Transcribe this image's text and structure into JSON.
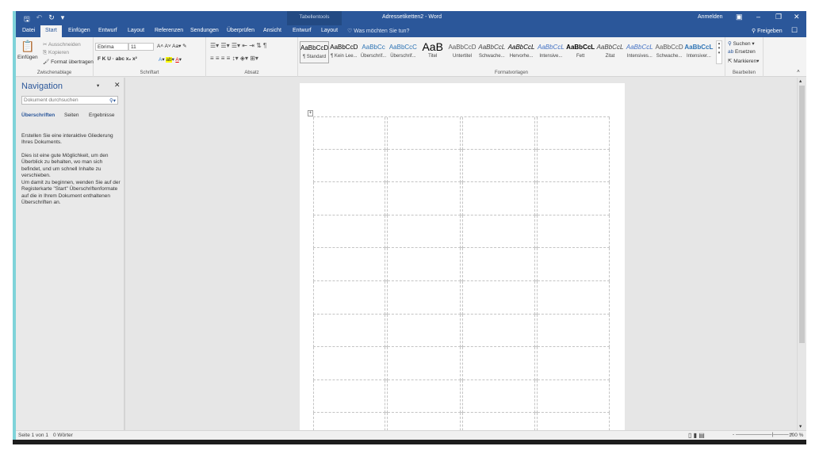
{
  "title": {
    "quick_access": [
      "save-icon",
      "undo-icon",
      "redo-icon",
      "customize-icon"
    ],
    "contextual": "Tabellentools",
    "document": "Adressetiketten2 - Word",
    "signin": "Anmelden",
    "window_controls": [
      "ribbon-options",
      "minimize",
      "restore",
      "close"
    ]
  },
  "tabs": [
    {
      "label": "Datei"
    },
    {
      "label": "Start",
      "active": true
    },
    {
      "label": "Einfügen"
    },
    {
      "label": "Entwurf"
    },
    {
      "label": "Layout"
    },
    {
      "label": "Referenzen"
    },
    {
      "label": "Sendungen"
    },
    {
      "label": "Überprüfen"
    },
    {
      "label": "Ansicht"
    },
    {
      "label": "Entwurf"
    },
    {
      "label": "Layout"
    }
  ],
  "tell_me": "Was möchten Sie tun?",
  "share": "Freigeben",
  "ribbon": {
    "clipboard": {
      "label": "Zwischenablage",
      "paste": "Einfügen",
      "cut": "Ausschneiden",
      "copy": "Kopieren",
      "format_painter": "Format übertragen"
    },
    "font": {
      "label": "Schriftart",
      "font_name": "Ebrima",
      "font_size": "11",
      "buttons": "F  K  U  ·  abc  x₂  x²"
    },
    "paragraph": {
      "label": "Absatz"
    },
    "styles": {
      "label": "Formatvorlagen",
      "items": [
        {
          "preview": "AaBbCcD",
          "name": "¶ Standard",
          "color": "#000"
        },
        {
          "preview": "AaBbCcD",
          "name": "¶ Kein Lee...",
          "color": "#000"
        },
        {
          "preview": "AaBbCc",
          "name": "Überschrif...",
          "color": "#2e74b5"
        },
        {
          "preview": "AaBbCcC",
          "name": "Überschrif...",
          "color": "#2e74b5"
        },
        {
          "preview": "AaB",
          "name": "Titel",
          "color": "#000"
        },
        {
          "preview": "AaBbCcD",
          "name": "Untertitel",
          "color": "#595959"
        },
        {
          "preview": "AaBbCcL",
          "name": "Schwache...",
          "color": "#404040"
        },
        {
          "preview": "AaBbCcL",
          "name": "Hervorhe...",
          "color": "#000"
        },
        {
          "preview": "AaBbCcL",
          "name": "Intensive...",
          "color": "#4472c4"
        },
        {
          "preview": "AaBbCcL",
          "name": "Fett",
          "color": "#000"
        },
        {
          "preview": "AaBbCcL",
          "name": "Zitat",
          "color": "#404040"
        },
        {
          "preview": "AaBbCcL",
          "name": "Intensives...",
          "color": "#4472c4"
        },
        {
          "preview": "AaBbCcD",
          "name": "Schwache...",
          "color": "#595959"
        },
        {
          "preview": "AaBbCcL",
          "name": "Intensiver...",
          "color": "#2e74b5"
        }
      ]
    },
    "editing": {
      "label": "Bearbeiten",
      "find": "Suchen",
      "replace": "Ersetzen",
      "select": "Markieren"
    }
  },
  "navigation": {
    "title": "Navigation",
    "search_placeholder": "Dokument durchsuchen",
    "tabs": [
      "Überschriften",
      "Seiten",
      "Ergebnisse"
    ],
    "paragraphs": [
      "Erstellen Sie eine interaktive Gliederung Ihres Dokuments.",
      "Dies ist eine gute Möglichkeit, um den Überblick zu behalten, wo man sich befindet, und um schnell Inhalte zu verschieben.",
      "Um damit zu beginnen, wenden Sie auf der Registerkarte \"Start\" Überschriftenformate auf die in Ihrem Dokument enthaltenen Überschriften an."
    ]
  },
  "status": {
    "page": "Seite 1 von 1",
    "words": "0 Wörter",
    "zoom": "100 %"
  },
  "colors": {
    "brand": "#2b579a",
    "contextual": "#234a83"
  }
}
